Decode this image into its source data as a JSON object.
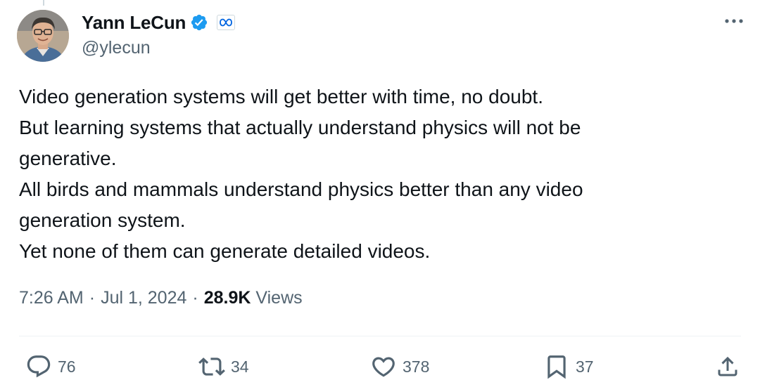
{
  "author": {
    "display_name": "Yann LeCun",
    "handle": "@ylecun",
    "verified_icon": "verified-badge-icon",
    "affiliate_icon": "meta-logo-icon",
    "avatar": "avatar"
  },
  "tweet": {
    "lines": [
      "Video generation systems will get better with time, no doubt.",
      "But learning systems that actually understand physics will not be",
      "generative.",
      "All birds and mammals understand physics better than any video",
      "generation system.",
      "Yet none of them can generate detailed videos."
    ],
    "time": "7:26 AM",
    "date": "Jul 1, 2024",
    "separator": "·",
    "views_count": "28.9K",
    "views_label": "Views"
  },
  "actions": {
    "replies": "76",
    "reposts": "34",
    "likes": "378",
    "bookmarks": "37"
  },
  "colors": {
    "text_primary": "#0f1419",
    "text_secondary": "#536471",
    "verified_blue": "#1d9bf0",
    "meta_blue": "#0064e0",
    "divider": "#eff3f4"
  }
}
